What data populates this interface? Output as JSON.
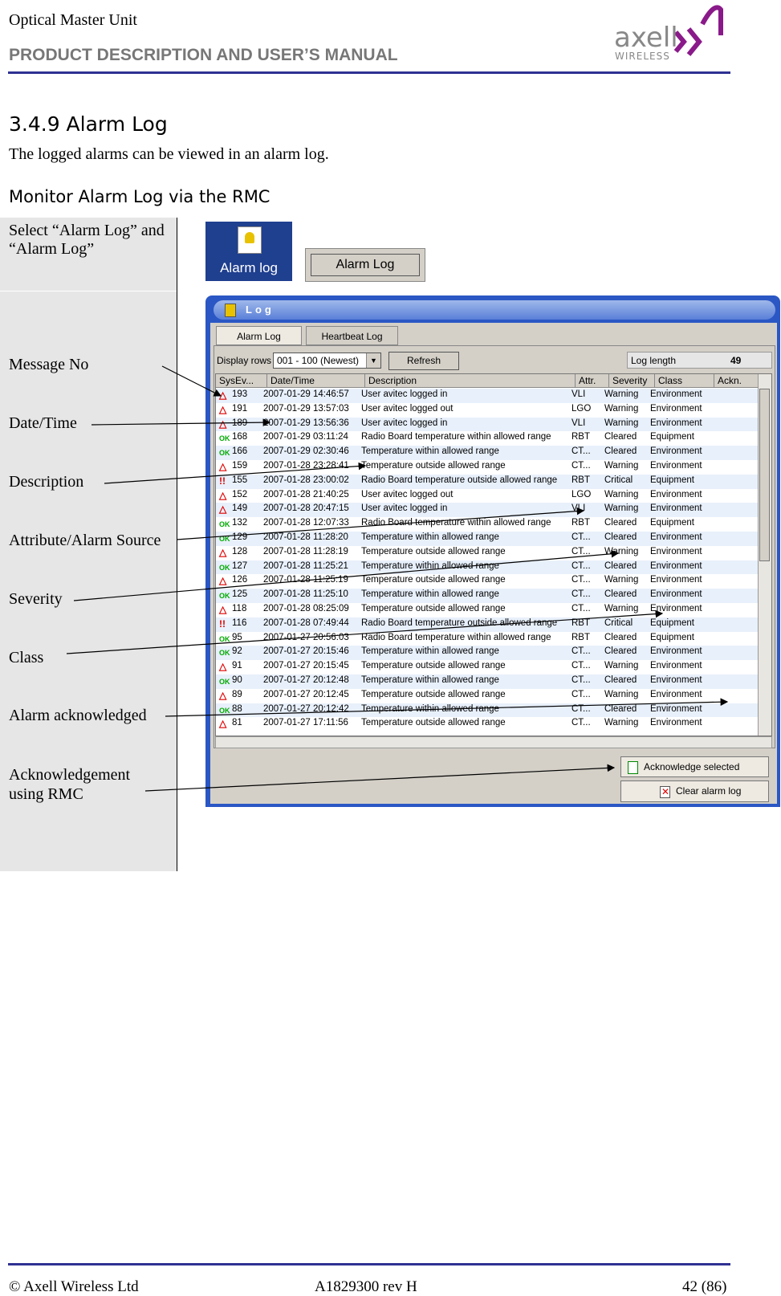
{
  "header": {
    "doc_title": "Optical Master Unit",
    "subtitle": "PRODUCT DESCRIPTION AND USER’S MANUAL",
    "logo_name": "axell",
    "logo_sub": "WIRELESS"
  },
  "section": {
    "title": "3.4.9 Alarm Log",
    "intro": "The logged alarms can be viewed in an alarm log.",
    "subtitle": "Monitor Alarm Log via the RMC"
  },
  "step": {
    "text": "Select “Alarm Log” and “Alarm Log”",
    "icon_button_label": "Alarm log",
    "menu_button_label": "Alarm Log"
  },
  "callouts": [
    "Message No",
    "Date/Time",
    "Description",
    "Attribute/Alarm Source",
    "Severity",
    "Class",
    "Alarm acknowledged",
    "Acknowledgement using RMC"
  ],
  "window": {
    "title": "Log",
    "tabs": [
      "Alarm Log",
      "Heartbeat Log"
    ],
    "display_rows_label": "Display rows",
    "display_rows_value": "001 - 100  (Newest)",
    "refresh_label": "Refresh",
    "log_length_label": "Log length",
    "log_length_value": "49",
    "columns": [
      "SysEv...",
      "Date/Time",
      "Description",
      "Attr.",
      "Severity",
      "Class",
      "Ackn."
    ],
    "rows": [
      {
        "status": "warn",
        "id": "193",
        "date": "2007-01-29  14:46:57",
        "desc": "User avitec logged in",
        "attr": "VLI",
        "sev": "Warning",
        "cls": "Environment"
      },
      {
        "status": "warn",
        "id": "191",
        "date": "2007-01-29  13:57:03",
        "desc": "User avitec logged out",
        "attr": "LGO",
        "sev": "Warning",
        "cls": "Environment"
      },
      {
        "status": "warn",
        "id": "189",
        "date": "2007-01-29  13:56:36",
        "desc": "User avitec logged in",
        "attr": "VLI",
        "sev": "Warning",
        "cls": "Environment"
      },
      {
        "status": "ok",
        "id": "168",
        "date": "2007-01-29  03:11:24",
        "desc": "Radio Board temperature within allowed range",
        "attr": "RBT",
        "sev": "Cleared",
        "cls": "Equipment"
      },
      {
        "status": "ok",
        "id": "166",
        "date": "2007-01-29  02:30:46",
        "desc": "Temperature within allowed range",
        "attr": "CT...",
        "sev": "Cleared",
        "cls": "Environment"
      },
      {
        "status": "warn",
        "id": "159",
        "date": "2007-01-28  23:28:41",
        "desc": "Temperature outside allowed range",
        "attr": "CT...",
        "sev": "Warning",
        "cls": "Environment"
      },
      {
        "status": "crit",
        "id": "155",
        "date": "2007-01-28  23:00:02",
        "desc": "Radio Board temperature outside allowed range",
        "attr": "RBT",
        "sev": "Critical",
        "cls": "Equipment"
      },
      {
        "status": "warn",
        "id": "152",
        "date": "2007-01-28  21:40:25",
        "desc": "User avitec logged out",
        "attr": "LGO",
        "sev": "Warning",
        "cls": "Environment"
      },
      {
        "status": "warn",
        "id": "149",
        "date": "2007-01-28  20:47:15",
        "desc": "User avitec logged in",
        "attr": "VLI",
        "sev": "Warning",
        "cls": "Environment"
      },
      {
        "status": "ok",
        "id": "132",
        "date": "2007-01-28  12:07:33",
        "desc": "Radio Board temperature within allowed range",
        "attr": "RBT",
        "sev": "Cleared",
        "cls": "Equipment"
      },
      {
        "status": "ok",
        "id": "129",
        "date": "2007-01-28  11:28:20",
        "desc": "Temperature within allowed range",
        "attr": "CT...",
        "sev": "Cleared",
        "cls": "Environment"
      },
      {
        "status": "warn",
        "id": "128",
        "date": "2007-01-28  11:28:19",
        "desc": "Temperature outside allowed range",
        "attr": "CT...",
        "sev": "Warning",
        "cls": "Environment"
      },
      {
        "status": "ok",
        "id": "127",
        "date": "2007-01-28  11:25:21",
        "desc": "Temperature within allowed range",
        "attr": "CT...",
        "sev": "Cleared",
        "cls": "Environment"
      },
      {
        "status": "warn",
        "id": "126",
        "date": "2007-01-28  11:25:19",
        "desc": "Temperature outside allowed range",
        "attr": "CT...",
        "sev": "Warning",
        "cls": "Environment"
      },
      {
        "status": "ok",
        "id": "125",
        "date": "2007-01-28  11:25:10",
        "desc": "Temperature within allowed range",
        "attr": "CT...",
        "sev": "Cleared",
        "cls": "Environment"
      },
      {
        "status": "warn",
        "id": "118",
        "date": "2007-01-28  08:25:09",
        "desc": "Temperature outside allowed range",
        "attr": "CT...",
        "sev": "Warning",
        "cls": "Environment"
      },
      {
        "status": "crit",
        "id": "116",
        "date": "2007-01-28  07:49:44",
        "desc": "Radio Board temperature outside allowed range",
        "attr": "RBT",
        "sev": "Critical",
        "cls": "Equipment"
      },
      {
        "status": "ok",
        "id": "95",
        "date": "2007-01-27  20:56:03",
        "desc": "Radio Board temperature within allowed range",
        "attr": "RBT",
        "sev": "Cleared",
        "cls": "Equipment"
      },
      {
        "status": "ok",
        "id": "92",
        "date": "2007-01-27  20:15:46",
        "desc": "Temperature within allowed range",
        "attr": "CT...",
        "sev": "Cleared",
        "cls": "Environment"
      },
      {
        "status": "warn",
        "id": "91",
        "date": "2007-01-27  20:15:45",
        "desc": "Temperature outside allowed range",
        "attr": "CT...",
        "sev": "Warning",
        "cls": "Environment"
      },
      {
        "status": "ok",
        "id": "90",
        "date": "2007-01-27  20:12:48",
        "desc": "Temperature within allowed range",
        "attr": "CT...",
        "sev": "Cleared",
        "cls": "Environment"
      },
      {
        "status": "warn",
        "id": "89",
        "date": "2007-01-27  20:12:45",
        "desc": "Temperature outside allowed range",
        "attr": "CT...",
        "sev": "Warning",
        "cls": "Environment"
      },
      {
        "status": "ok",
        "id": "88",
        "date": "2007-01-27  20:12:42",
        "desc": "Temperature within allowed range",
        "attr": "CT...",
        "sev": "Cleared",
        "cls": "Environment"
      },
      {
        "status": "warn",
        "id": "81",
        "date": "2007-01-27  17:11:56",
        "desc": "Temperature outside allowed range",
        "attr": "CT...",
        "sev": "Warning",
        "cls": "Environment"
      }
    ],
    "ack_button_label": "Acknowledge selected alarms",
    "clear_button_label": "Clear alarm log"
  },
  "footer": {
    "left": "© Axell Wireless Ltd",
    "center": "A1829300 rev H",
    "right": "42 (86)"
  },
  "colors": {
    "rule": "#2e3192",
    "logo_purple": "#8a1a8a",
    "logo_grey": "#888888"
  }
}
